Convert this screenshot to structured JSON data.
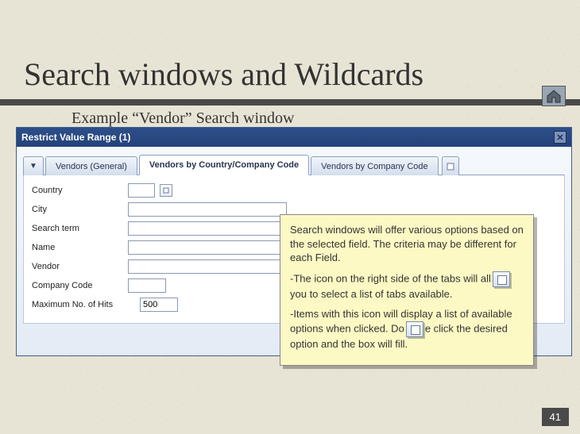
{
  "slide": {
    "title": "Search windows and Wildcards",
    "subtitle": "Example “Vendor” Search window",
    "number": "41"
  },
  "home_icon": "home-icon",
  "sap": {
    "title": "Restrict Value Range (1)",
    "close_label": "✕",
    "tab_arrow": "▼",
    "tabs": {
      "general": "Vendors (General)",
      "country": "Vendors by Country/Company Code",
      "company": "Vendors by Company Code"
    },
    "fields": {
      "country": {
        "label": "Country",
        "value": ""
      },
      "city": {
        "label": "City",
        "value": ""
      },
      "search_term": {
        "label": "Search term",
        "value": ""
      },
      "name": {
        "label": "Name",
        "value": ""
      },
      "vendor": {
        "label": "Vendor",
        "value": ""
      },
      "company_code": {
        "label": "Company Code",
        "value": ""
      },
      "max_hits": {
        "label": "Maximum No. of Hits",
        "value": "500"
      }
    }
  },
  "callout": {
    "p1": "  Search windows will offer various options based on the selected field.  The criteria may be different for each Field.",
    "p2a": "-The icon on the right side of the tabs will all",
    "p2b": "you to select a list of tabs available.",
    "p3a": "-Items with this icon will display a list of available options when clicked.  Do",
    "p3b": "e click the desired option and the box will fill."
  }
}
